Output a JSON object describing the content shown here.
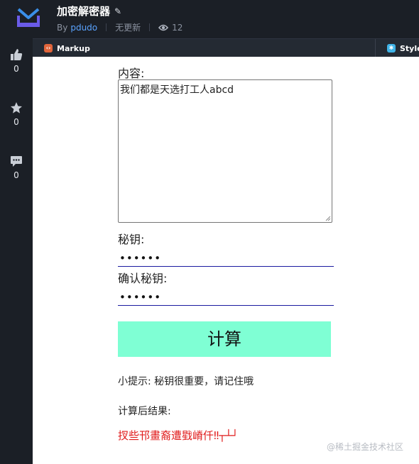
{
  "header": {
    "title": "加密解密器",
    "by": "By",
    "author": "pdudo",
    "update_status": "无更新",
    "views": "12",
    "icons": {
      "logo": "brand-logo",
      "edit": "pencil-icon",
      "views": "eye-icon"
    }
  },
  "tabs": [
    {
      "label": "Markup",
      "icon": "markup-icon",
      "color": "#e0643a"
    },
    {
      "label": "Style",
      "icon": "style-icon",
      "color": "#3fb3e7"
    }
  ],
  "rail": {
    "like_count": "0",
    "star_count": "0",
    "comment_count": "0"
  },
  "form": {
    "content_label": "内容:",
    "content_value": "我们都是天选打工人abcd",
    "key_label": "秘钥:",
    "key_value": "••••••",
    "confirm_label": "确认秘钥:",
    "confirm_value": "••••••",
    "submit_label": "计算",
    "submit_color": "#7fffd4"
  },
  "hint": "小提示: 秘钥很重要，请记住哦",
  "result_label": "计算后结果:",
  "result_value": "扠些邗畫裔遭戥嵴仟‼┬┴┘",
  "result_color": "#e01b1b",
  "watermark": "@稀土掘金技术社区"
}
